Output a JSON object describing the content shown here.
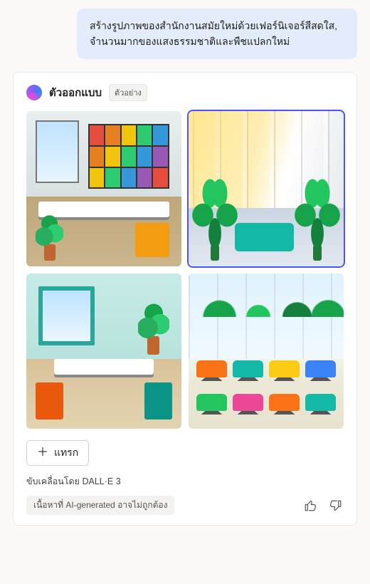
{
  "user_message": "สร้างรูปภาพของสำนักงานสมัยใหม่ด้วยเฟอร์นิเจอร์สีสดใส, จำนวนมากของแสงธรรมชาติและพืชแปลกใหม่",
  "card": {
    "title": "ตัวออกแบบ",
    "badge": "ตัวอย่าง",
    "insert_label": "แทรก",
    "powered_by": "ขับเคลื่อนโดย DALL·E 3",
    "disclaimer": "เนื้อหาที่ AI-generated อาจไม่ถูกต้อง"
  },
  "images": [
    {
      "desc": "modern-office-rainbow-bookshelf",
      "selected": false
    },
    {
      "desc": "sunlit-office-palms",
      "selected": true
    },
    {
      "desc": "teal-orange-office-room",
      "selected": false
    },
    {
      "desc": "open-plan-colorful-chairs",
      "selected": false
    }
  ],
  "icons": {
    "designer": "designer-logo",
    "plus": "plus-icon",
    "thumbs_up": "thumbs-up-icon",
    "thumbs_down": "thumbs-down-icon"
  }
}
